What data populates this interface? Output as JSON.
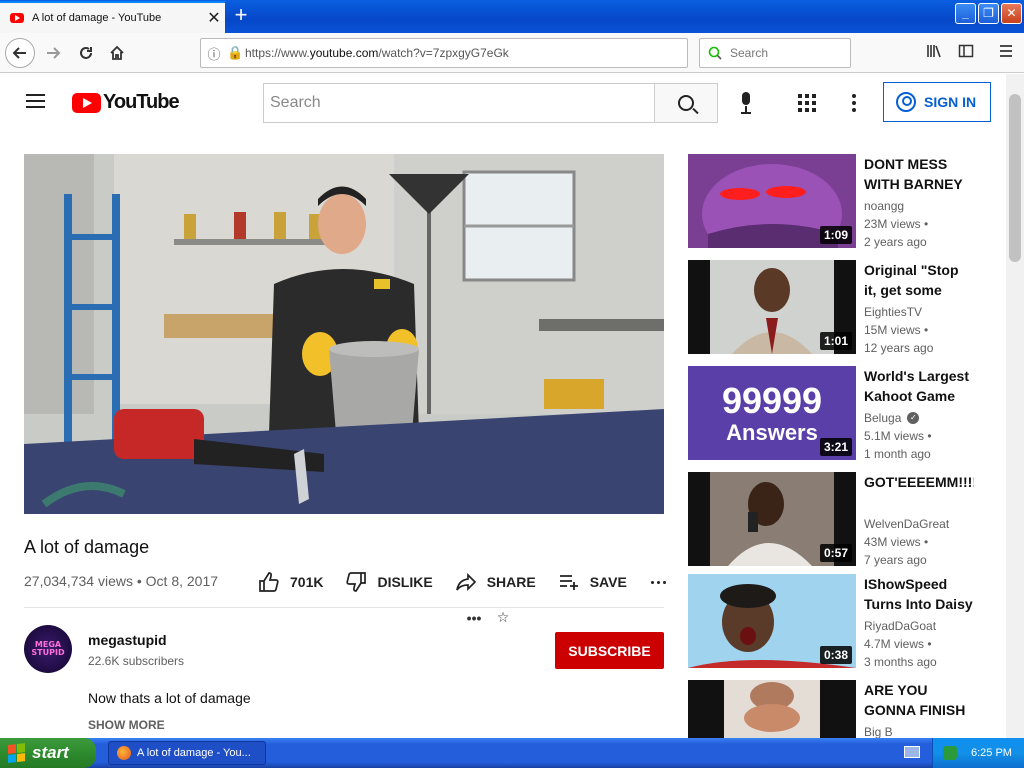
{
  "browser": {
    "tab_title": "A lot of damage - YouTube",
    "tab_close": "✕",
    "new_tab": "+",
    "window_buttons": [
      "_",
      "❐",
      "✕"
    ],
    "url_prefix": "https://www.",
    "url_domain": "youtube.com",
    "url_path": "/watch?v=7zpxgyG7eGk",
    "search_placeholder": "Search",
    "url_menu": "•••",
    "bookmark_star": "☆"
  },
  "youtube": {
    "logo_text": "YouTube",
    "search_placeholder": "Search",
    "signin_label": "SIGN IN"
  },
  "video": {
    "title": "A lot of damage",
    "views_date": "27,034,734 views • Oct 8, 2017",
    "likes": "701K",
    "dislike_label": "DISLIKE",
    "share_label": "SHARE",
    "save_label": "SAVE"
  },
  "channel": {
    "name": "megastupid",
    "avatar_text": "MEGA STUPID",
    "subscribers": "22.6K subscribers",
    "subscribe_label": "SUBSCRIBE",
    "description": "Now thats a lot of damage",
    "show_more": "SHOW MORE"
  },
  "recommendations": [
    {
      "title": "DONT MESS WITH BARNEY",
      "channel": "noangg",
      "views": "23M views •",
      "age": "2 years ago",
      "duration": "1:09",
      "verified": false
    },
    {
      "title": "Original \"Stop it, get some help\"",
      "channel": "EightiesTV",
      "views": "15M views •",
      "age": "12 years ago",
      "duration": "1:01",
      "verified": false
    },
    {
      "title": "World's Largest Kahoot Game Ever",
      "channel": "Beluga",
      "views": "5.1M views •",
      "age": "1 month ago",
      "duration": "3:21",
      "verified": true,
      "thumb_text_1": "99999",
      "thumb_text_2": "Answers"
    },
    {
      "title": "GOT'EEEEMM!!!!",
      "channel": "WelvenDaGreat",
      "views": "43M views •",
      "age": "7 years ago",
      "duration": "0:57",
      "verified": false
    },
    {
      "title": "IShowSpeed Turns Into Daisy",
      "channel": "RiyadDaGoat",
      "views": "4.7M views •",
      "age": "3 months ago",
      "duration": "0:38",
      "verified": false
    },
    {
      "title": "ARE YOU GONNA FINISH THAT",
      "channel": "Big B",
      "views": "",
      "age": "",
      "duration": "",
      "verified": false
    }
  ],
  "taskbar": {
    "start_label": "start",
    "task_label": "A lot of damage - You...",
    "clock": "6:25 PM"
  },
  "colors": {
    "yt_red": "#ff0000",
    "subscribe_red": "#cc0000",
    "signin_blue": "#065fd4",
    "xp_blue": "#245edb",
    "xp_green": "#2e8b2e"
  },
  "icons": [
    "back-arrow-icon",
    "forward-arrow-icon",
    "reload-icon",
    "home-icon",
    "info-icon",
    "lock-icon",
    "library-icon",
    "sidebar-icon",
    "menu-icon",
    "search-icon",
    "mic-icon",
    "apps-icon",
    "more-vert-icon",
    "user-icon",
    "like-icon",
    "dislike-icon",
    "share-icon",
    "playlist-add-icon",
    "more-horiz-icon",
    "verified-icon",
    "windows-flag-icon"
  ]
}
